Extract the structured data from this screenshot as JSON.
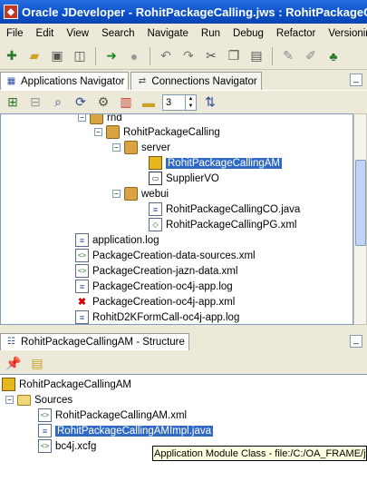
{
  "window": {
    "title": "Oracle JDeveloper - RohitPackageCalling.jws : RohitPackageCalling"
  },
  "menu": [
    "File",
    "Edit",
    "View",
    "Search",
    "Navigate",
    "Run",
    "Debug",
    "Refactor",
    "Versioning"
  ],
  "panels": {
    "top_tabs": [
      "Applications Navigator",
      "Connections Navigator"
    ],
    "level_value": "3",
    "structure_tab": "RohitPackageCallingAM - Structure"
  },
  "nav_tree": {
    "rows": [
      {
        "label": "rnd"
      },
      {
        "label": "RohitPackageCalling"
      },
      {
        "label": "server"
      },
      {
        "label": "RohitPackageCallingAM"
      },
      {
        "label": "SupplierVO"
      },
      {
        "label": "webui"
      },
      {
        "label": "RohitPackageCallingCO.java"
      },
      {
        "label": "RohitPackageCallingPG.xml"
      },
      {
        "label": "application.log"
      },
      {
        "label": "PackageCreation-data-sources.xml"
      },
      {
        "label": "PackageCreation-jazn-data.xml"
      },
      {
        "label": "PackageCreation-oc4j-app.log"
      },
      {
        "label": "PackageCreation-oc4j-app.xml"
      },
      {
        "label": "RohitD2KFormCall-oc4j-app.log"
      }
    ]
  },
  "structure_tree": {
    "rows": [
      {
        "label": "RohitPackageCallingAM"
      },
      {
        "label": "Sources"
      },
      {
        "label": "RohitPackageCallingAM.xml"
      },
      {
        "label": "RohitPackageCallingAMImpl.java"
      },
      {
        "label": "bc4j.xcfg"
      }
    ]
  },
  "tooltip": {
    "text": "Application Module Class - file:/C:/OA_FRAME/jdev"
  },
  "icons": [
    "save-icon",
    "folder-open-icon",
    "run-icon",
    "undo-icon",
    "redo-icon",
    "cut-icon",
    "copy-icon",
    "paste-icon",
    "pin-icon"
  ],
  "colors": {
    "title_bar": "#0a4fc8",
    "selection": "#316ac5",
    "tooltip_bg": "#ffffe1"
  }
}
